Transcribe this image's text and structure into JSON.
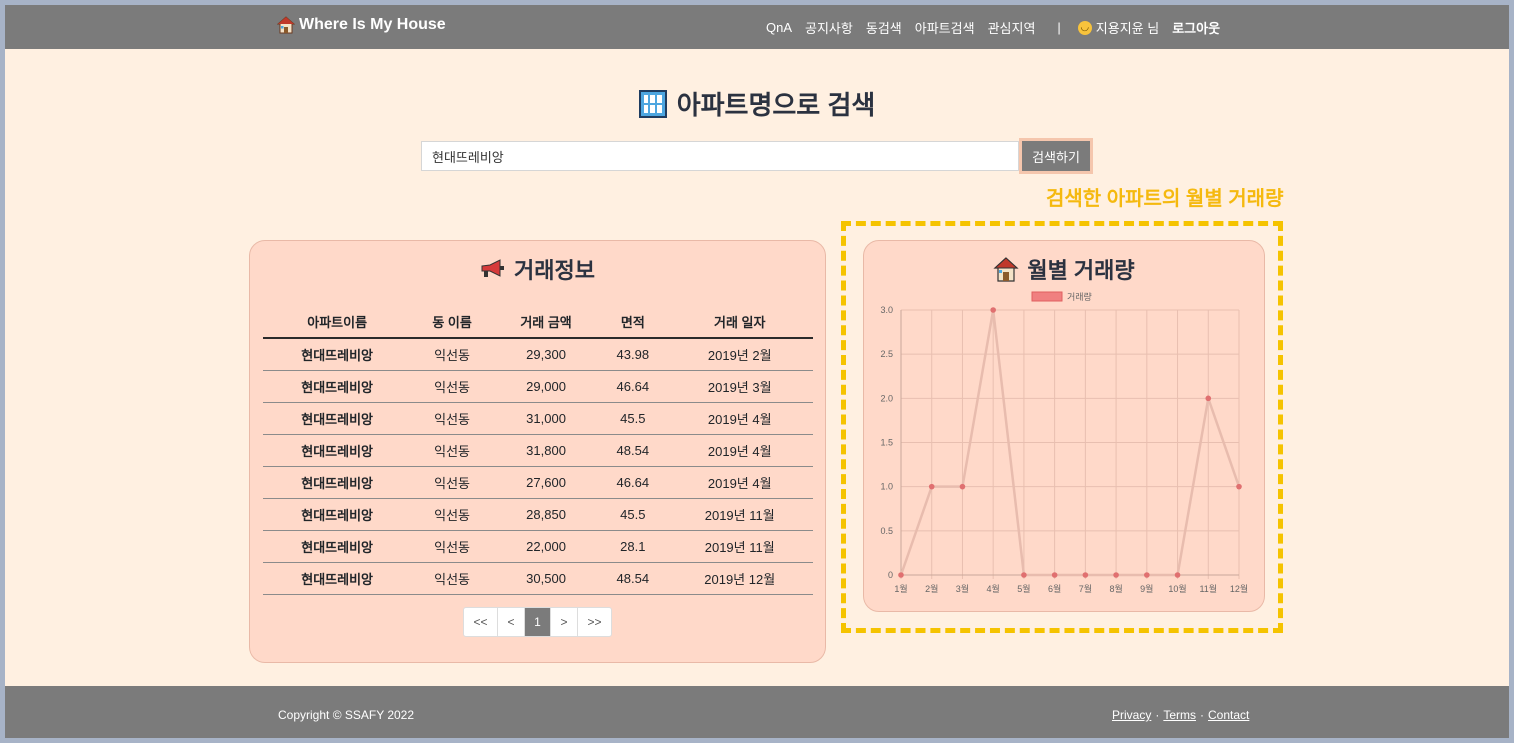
{
  "nav": {
    "brand": "Where Is My House",
    "links": [
      "QnA",
      "공지사항",
      "동검색",
      "아파트검색",
      "관심지역"
    ],
    "separator": "|",
    "user_name": "지용지윤 님",
    "logout": "로그아웃"
  },
  "page": {
    "title": "아파트명으로 검색"
  },
  "search": {
    "value": "현대뜨레비앙",
    "button": "검색하기"
  },
  "annotation": "검색한 아파트의 월별 거래량",
  "deals": {
    "title": "거래정보",
    "columns": [
      "아파트이름",
      "동 이름",
      "거래 금액",
      "면적",
      "거래 일자"
    ],
    "rows": [
      [
        "현대뜨레비앙",
        "익선동",
        "29,300",
        "43.98",
        "2019년 2월"
      ],
      [
        "현대뜨레비앙",
        "익선동",
        "29,000",
        "46.64",
        "2019년 3월"
      ],
      [
        "현대뜨레비앙",
        "익선동",
        "31,000",
        "45.5",
        "2019년 4월"
      ],
      [
        "현대뜨레비앙",
        "익선동",
        "31,800",
        "48.54",
        "2019년 4월"
      ],
      [
        "현대뜨레비앙",
        "익선동",
        "27,600",
        "46.64",
        "2019년 4월"
      ],
      [
        "현대뜨레비앙",
        "익선동",
        "28,850",
        "45.5",
        "2019년 11월"
      ],
      [
        "현대뜨레비앙",
        "익선동",
        "22,000",
        "28.1",
        "2019년 11월"
      ],
      [
        "현대뜨레비앙",
        "익선동",
        "30,500",
        "48.54",
        "2019년 12월"
      ]
    ],
    "pager": [
      "<<",
      "<",
      "1",
      ">",
      ">>"
    ],
    "current_page": "1"
  },
  "monthly": {
    "title": "월별 거래량"
  },
  "chart_data": {
    "type": "line",
    "title": "",
    "categories": [
      "1월",
      "2월",
      "3월",
      "4월",
      "5월",
      "6월",
      "7월",
      "8월",
      "9월",
      "10월",
      "11월",
      "12월"
    ],
    "series": [
      {
        "name": "거래량",
        "values": [
          0,
          1,
          1,
          3,
          0,
          0,
          0,
          0,
          0,
          0,
          2,
          1
        ]
      }
    ],
    "ylim": [
      0,
      3
    ],
    "yticks": [
      "0",
      "0.5",
      "1.0",
      "1.5",
      "2.0",
      "2.5",
      "3.0"
    ],
    "grid": true,
    "legend": "top-center",
    "line_color": "#e8bcae",
    "point_color": "#e07070",
    "legend_color": "#f08080"
  },
  "footer": {
    "copyright": "Copyright © SSAFY 2022",
    "links": [
      "Privacy",
      "Terms",
      "Contact"
    ],
    "separator": "·"
  },
  "colors": {
    "nav": "#7b7b7b",
    "page_bg": "#fff0e1",
    "card_bg": "#ffd9c9",
    "highlight": "#f5c300"
  },
  "icons": {
    "brand": "house-icon",
    "title": "building-icon",
    "deals": "megaphone-icon",
    "monthly": "house-icon",
    "user": "smile-icon"
  }
}
